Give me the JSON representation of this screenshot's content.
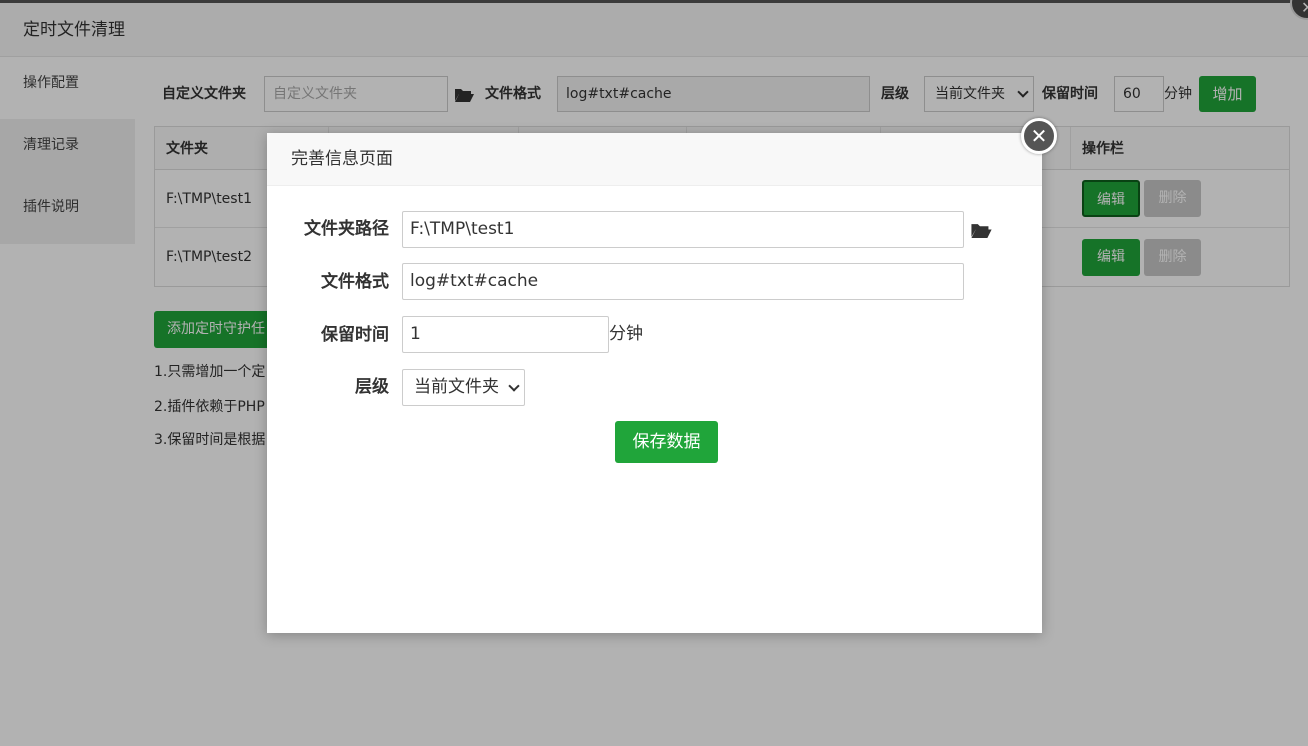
{
  "window": {
    "title": "定时文件清理",
    "close_glyph": "✕"
  },
  "sidebar": {
    "items": [
      {
        "label": "操作配置"
      },
      {
        "label": "清理记录"
      },
      {
        "label": "插件说明"
      }
    ]
  },
  "toolbar": {
    "custom_folder_label": "自定义文件夹",
    "custom_folder_placeholder": "自定义文件夹",
    "format_label": "文件格式",
    "format_value": "log#txt#cache",
    "level_label": "层级",
    "level_value": "当前文件夹",
    "retain_label": "保留时间",
    "retain_value": "60",
    "retain_unit": "分钟",
    "add_button": "增加"
  },
  "table": {
    "headers": {
      "folder": "文件夹",
      "actions": "操作栏"
    },
    "rows": [
      {
        "folder": "F:\\TMP\\test1",
        "edit": "编辑",
        "delete": "删除"
      },
      {
        "folder": "F:\\TMP\\test2",
        "edit": "编辑",
        "delete": "删除"
      }
    ]
  },
  "add_guard_button": "添加定时守护任",
  "notes": [
    "1.只需增加一个定",
    "2.插件依赖于PHP",
    "3.保留时间是根据"
  ],
  "modal": {
    "title": "完善信息页面",
    "close_glyph": "✕",
    "fields": {
      "path_label": "文件夹路径",
      "path_value": "F:\\TMP\\test1",
      "format_label": "文件格式",
      "format_value": "log#txt#cache",
      "retain_label": "保留时间",
      "retain_value": "1",
      "retain_unit": "分钟",
      "level_label": "层级",
      "level_value": "当前文件夹"
    },
    "save_button": "保存数据"
  },
  "colors": {
    "accent": "#20a53a",
    "disabled": "#c8c8c8"
  }
}
